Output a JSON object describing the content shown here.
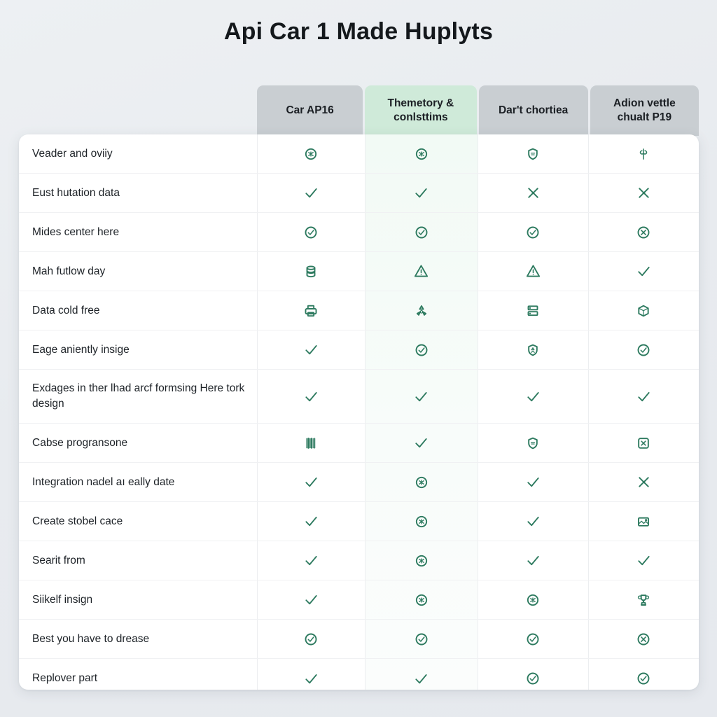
{
  "page": {
    "title": "Api Car 1 Made Huplyts",
    "background_color": "#eaedf1",
    "card_color": "#ffffff",
    "icon_color": "#2d7a5f",
    "header_color": "#c9ced2",
    "highlight_color": "#cfead9"
  },
  "table": {
    "feature_column_header": "",
    "columns": [
      {
        "label": "Car AP16",
        "highlighted": false
      },
      {
        "label": "Themetory & conlsttims",
        "highlighted": true
      },
      {
        "label": "Dar't chortiea",
        "highlighted": false
      },
      {
        "label": "Adion vettle chualt P19",
        "highlighted": false
      }
    ],
    "rows": [
      {
        "label": "Veader and oviiy",
        "tall": false,
        "cells": [
          "circle-glyph",
          "circle-glyph",
          "shield-glyph",
          "scissors-glyph"
        ]
      },
      {
        "label": "Eust hutation data",
        "tall": false,
        "cells": [
          "check",
          "check",
          "cross",
          "cross"
        ]
      },
      {
        "label": "Mides center here",
        "tall": false,
        "cells": [
          "circle-check",
          "circle-check",
          "circle-check",
          "circle-cross"
        ]
      },
      {
        "label": "Mah futlow day",
        "tall": false,
        "cells": [
          "database",
          "warning-triangle",
          "warning-triangle",
          "check"
        ]
      },
      {
        "label": "Data cold free",
        "tall": false,
        "cells": [
          "printer",
          "recycle",
          "server",
          "cube"
        ]
      },
      {
        "label": "Eage aniently insige",
        "tall": false,
        "cells": [
          "check",
          "circle-check",
          "recycle-shield",
          "circle-check"
        ]
      },
      {
        "label": "Exdages in ther lhad arcf formsing Here tork design",
        "tall": true,
        "cells": [
          "check",
          "check",
          "check",
          "check"
        ]
      },
      {
        "label": "Cabse progransone",
        "tall": false,
        "cells": [
          "barcode",
          "check",
          "shield-glyph",
          "square-cross"
        ]
      },
      {
        "label": "Integration nadel aı eally date",
        "tall": false,
        "cells": [
          "check",
          "circle-glyph",
          "check",
          "cross"
        ]
      },
      {
        "label": "Create stobel cace",
        "tall": false,
        "cells": [
          "check",
          "circle-glyph",
          "check",
          "image-frame"
        ]
      },
      {
        "label": "Searit from",
        "tall": false,
        "cells": [
          "check",
          "circle-glyph",
          "check",
          "check"
        ]
      },
      {
        "label": "Siikelf insign",
        "tall": false,
        "cells": [
          "check",
          "circle-glyph",
          "circle-glyph",
          "trophy"
        ]
      },
      {
        "label": "Best you have to drease",
        "tall": false,
        "cells": [
          "circle-check",
          "circle-check",
          "circle-check",
          "circle-cross"
        ]
      },
      {
        "label": "Replover part",
        "tall": false,
        "cells": [
          "check",
          "check",
          "circle-check",
          "circle-check"
        ]
      }
    ]
  }
}
